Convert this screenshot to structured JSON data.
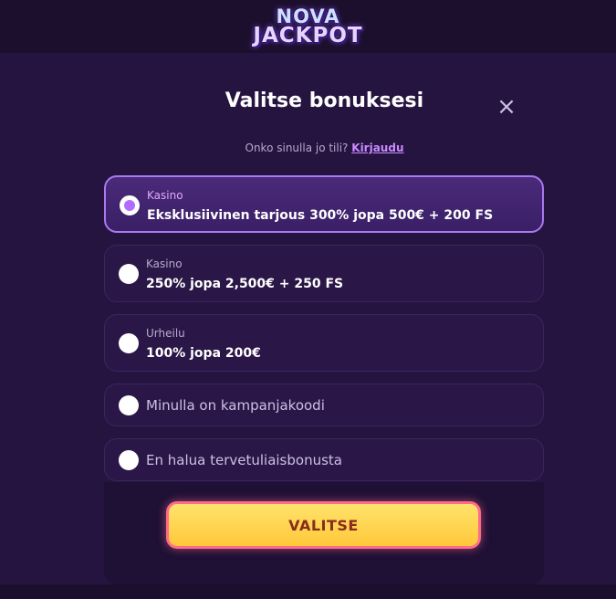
{
  "logo": {
    "line1": "NOVA",
    "line2": "JACKPOT"
  },
  "modal": {
    "title": "Valitse bonuksesi",
    "close_symbol": "×",
    "login_prompt": "Onko sinulla jo tili?",
    "login_link": "Kirjaudu"
  },
  "options": [
    {
      "category": "Kasino",
      "text": "Eksklusiivinen tarjous 300% jopa 500€ + 200 FS",
      "selected": true
    },
    {
      "category": "Kasino",
      "text": "250% jopa 2,500€ + 250 FS",
      "selected": false
    },
    {
      "category": "Urheilu",
      "text": "100% jopa 200€",
      "selected": false
    },
    {
      "text": "Minulla on kampanjakoodi",
      "selected": false
    },
    {
      "text": "En halua tervetuliaisbonusta",
      "selected": false
    }
  ],
  "cta": {
    "label": "VALITSE"
  },
  "colors": {
    "accent": "#a879f0",
    "cta": "#ffd24a",
    "cta_border": "#ff6b8a",
    "background": "#261440"
  }
}
